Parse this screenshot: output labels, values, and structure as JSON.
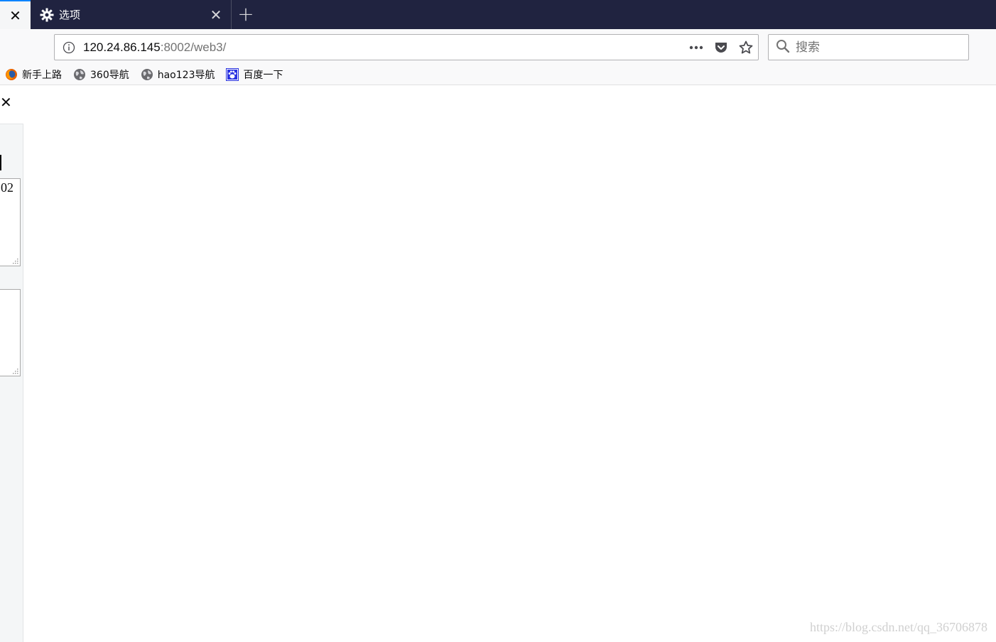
{
  "tabs": {
    "active_title": "选项"
  },
  "urlbar": {
    "host": "120.24.86.145",
    "rest": ":8002/web3/"
  },
  "search": {
    "placeholder": "搜索"
  },
  "bookmarks": [
    {
      "label": "新手上路",
      "icon": "firefox-icon"
    },
    {
      "label": "360导航",
      "icon": "globe-icon"
    },
    {
      "label": "hao123导航",
      "icon": "globe-icon"
    },
    {
      "label": "百度一下",
      "icon": "baidu-paw-icon"
    }
  ],
  "sidebar": {
    "textarea1_value": "02",
    "textarea2_value": ""
  },
  "watermark": "https://blog.csdn.net/qq_36706878",
  "colors": {
    "tabstrip": "#202340",
    "accent": "#0a84ff"
  }
}
